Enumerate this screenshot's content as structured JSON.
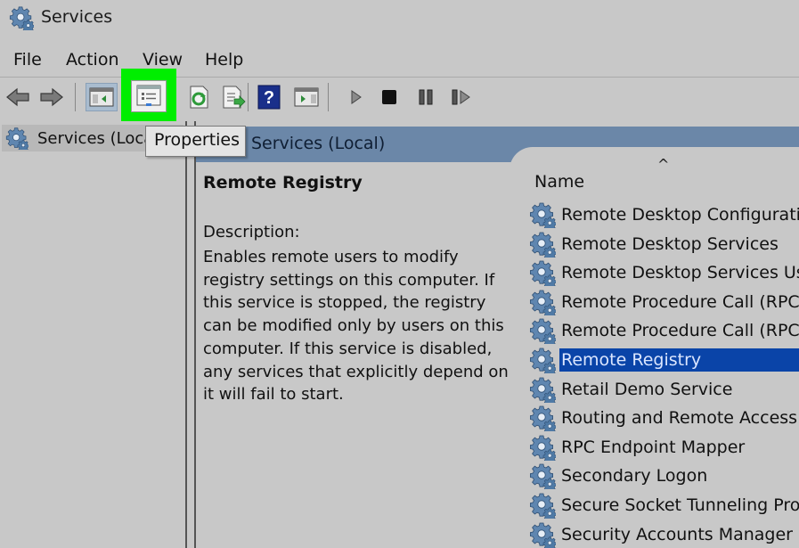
{
  "window": {
    "title": "Services",
    "icon": "gear-icon"
  },
  "menu": [
    {
      "label": "File"
    },
    {
      "label": "Action"
    },
    {
      "label": "View"
    },
    {
      "label": "Help"
    }
  ],
  "toolbar": {
    "buttons": [
      {
        "name": "back",
        "icon": "arrow-left-icon"
      },
      {
        "name": "forward",
        "icon": "arrow-right-icon"
      },
      {
        "name": "show-hide-console-tree",
        "icon": "console-tree-icon",
        "pressed": true
      },
      {
        "name": "properties",
        "icon": "properties-icon",
        "highlighted": true
      },
      {
        "name": "refresh",
        "icon": "refresh-icon"
      },
      {
        "name": "export-list",
        "icon": "export-list-icon"
      },
      {
        "name": "help",
        "icon": "help-icon"
      },
      {
        "name": "show-hide-action-pane",
        "icon": "action-pane-icon"
      },
      {
        "name": "start-service",
        "icon": "play-icon"
      },
      {
        "name": "stop-service",
        "icon": "stop-icon"
      },
      {
        "name": "pause-service",
        "icon": "pause-icon"
      },
      {
        "name": "restart-service",
        "icon": "restart-icon"
      }
    ],
    "highlight_color": "#00ee00"
  },
  "tooltip": {
    "text": "Properties"
  },
  "tree": {
    "items": [
      {
        "label": "Services (Local)"
      }
    ]
  },
  "right_header": {
    "title": "Services (Local)"
  },
  "details": {
    "service_name": "Remote Registry",
    "description_label": "Description:",
    "description": "Enables remote users to modify registry settings on this computer. If this service is stopped, the registry can be modified only by users on this computer. If this service is disabled, any services that explicitly depend on it will fail to start."
  },
  "list": {
    "sort_indicator": "^",
    "columns": [
      {
        "label": "Name"
      }
    ],
    "rows": [
      {
        "name": "Remote Desktop Configurati..."
      },
      {
        "name": "Remote Desktop Services"
      },
      {
        "name": "Remote Desktop Services Us..."
      },
      {
        "name": "Remote Procedure Call (RPC)"
      },
      {
        "name": "Remote Procedure Call (RPC)..."
      },
      {
        "name": "Remote Registry",
        "selected": true
      },
      {
        "name": "Retail Demo Service"
      },
      {
        "name": "Routing and Remote Access"
      },
      {
        "name": "RPC Endpoint Mapper"
      },
      {
        "name": "Secondary Logon"
      },
      {
        "name": "Secure Socket Tunneling Pro..."
      },
      {
        "name": "Security Accounts Manager"
      }
    ]
  },
  "colors": {
    "background": "#c8c8c8",
    "header_bar": "#6b87a8",
    "selection": "#0a44a8",
    "selection_text": "#dbe6ff"
  }
}
